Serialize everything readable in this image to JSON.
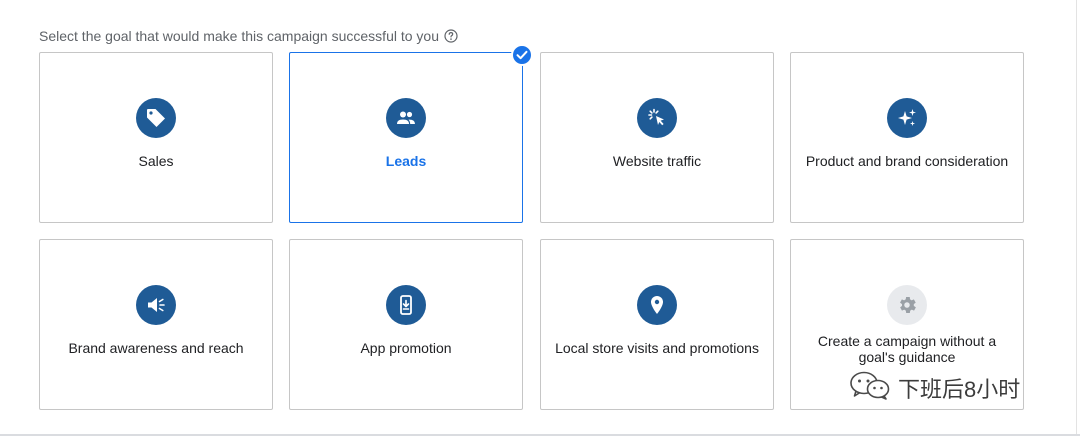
{
  "prompt": {
    "text": "Select the goal that would make this campaign successful to you",
    "help_icon": "help-circle-icon"
  },
  "goals": [
    {
      "label": "Sales",
      "icon": "tag-icon",
      "selected": false
    },
    {
      "label": "Leads",
      "icon": "people-icon",
      "selected": true
    },
    {
      "label": "Website traffic",
      "icon": "cursor-click-icon",
      "selected": false
    },
    {
      "label": "Product and brand consideration",
      "icon": "sparkle-icon",
      "selected": false
    },
    {
      "label": "Brand awareness and reach",
      "icon": "speaker-icon",
      "selected": false
    },
    {
      "label": "App promotion",
      "icon": "mobile-app-icon",
      "selected": false
    },
    {
      "label": "Local store visits and promotions",
      "icon": "location-pin-icon",
      "selected": false
    },
    {
      "label": "Create a campaign without a goal's guidance",
      "icon": "gear-icon",
      "selected": false
    }
  ],
  "colors": {
    "icon_circle": "#1f5b96",
    "selected_accent": "#1a73e8",
    "card_border": "#c6c6c6",
    "disabled_circle": "#e8eaed"
  },
  "watermark": {
    "text": "下班后8小时",
    "icon": "wechat-icon"
  }
}
